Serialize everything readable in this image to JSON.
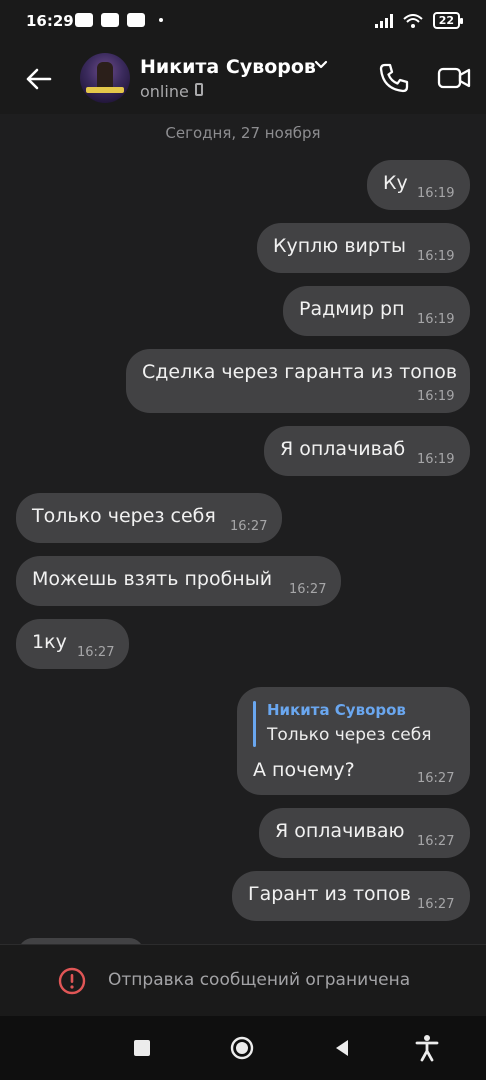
{
  "status_bar": {
    "time": "16:29",
    "battery": "22"
  },
  "header": {
    "contact_name": "Никита Суворов",
    "contact_status": "online"
  },
  "chat": {
    "date_separator": "Сегодня, 27 ноября",
    "messages": [
      {
        "direction": "out",
        "text": "Ку",
        "time": "16:19"
      },
      {
        "direction": "out",
        "text": "Куплю вирты",
        "time": "16:19"
      },
      {
        "direction": "out",
        "text": "Радмир рп",
        "time": "16:19"
      },
      {
        "direction": "out",
        "text": "Сделка через гаранта из топов",
        "time": "16:19"
      },
      {
        "direction": "out",
        "text": "Я оплачиваб",
        "time": "16:19"
      },
      {
        "direction": "in",
        "text": "Только через себя",
        "time": "16:27"
      },
      {
        "direction": "in",
        "text": "Можешь взять пробный",
        "time": "16:27"
      },
      {
        "direction": "in",
        "text": "1ку",
        "time": "16:27"
      },
      {
        "direction": "out",
        "text": "А почему?",
        "time": "16:27",
        "reply_to": {
          "name": "Никита Суворов",
          "text": "Только через себя"
        }
      },
      {
        "direction": "out",
        "text": "Я оплачиваю",
        "time": "16:27"
      },
      {
        "direction": "out",
        "text": "Гарант из топов",
        "time": "16:27"
      }
    ]
  },
  "restriction": {
    "text": "Отправка сообщений ограничена"
  },
  "colors": {
    "background": "#1e1e1f",
    "bubble": "#424244",
    "reply_accent": "#6aa7f0",
    "warning": "#e05656"
  }
}
